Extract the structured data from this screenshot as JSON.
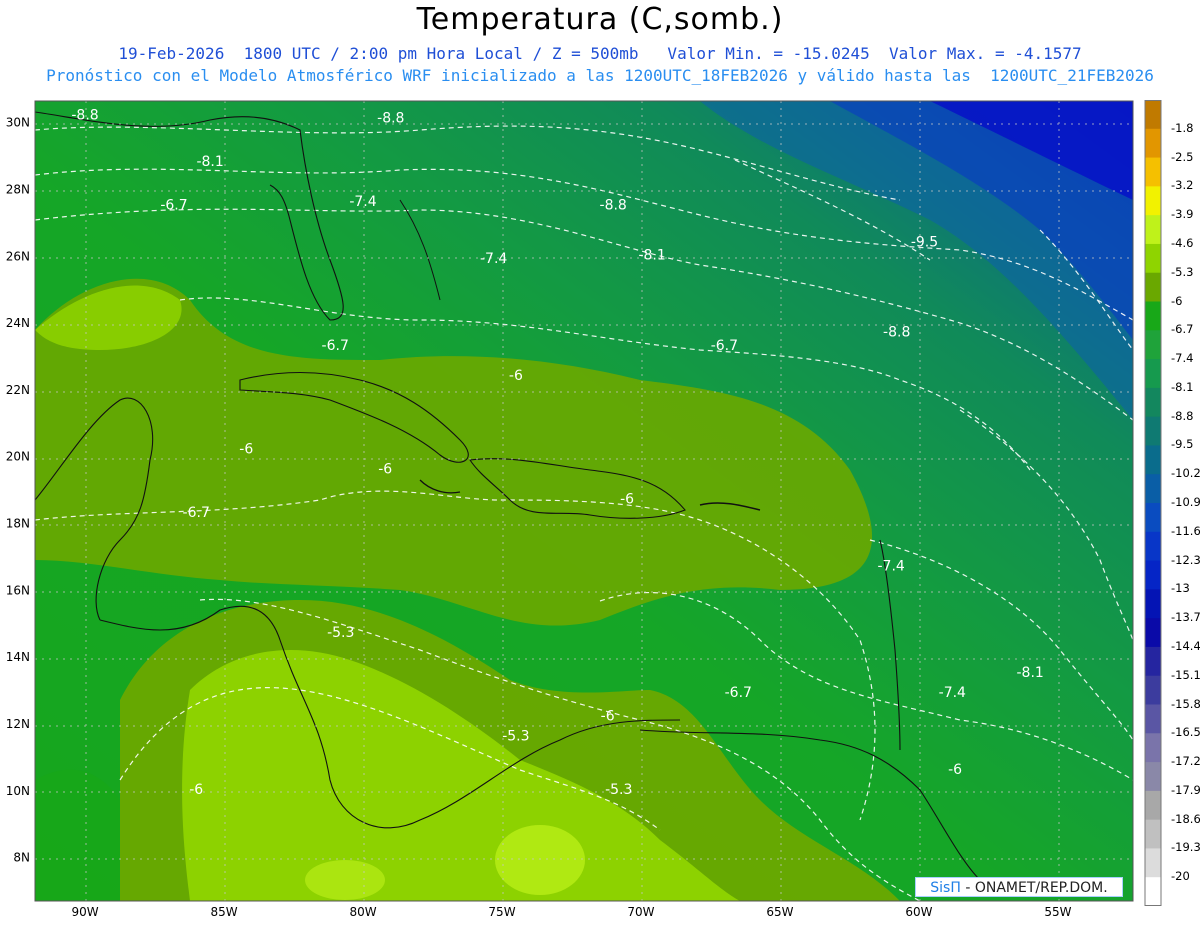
{
  "title": "Temperatura (C,somb.)",
  "subtitle_line1": "19-Feb-2026  1800 UTC / 2:00 pm Hora Local / Z = 500mb   Valor Min. = -15.0245  Valor Max. = -4.1577",
  "subtitle_line2": "Pronóstico con el Modelo Atmosférico WRF inicializado a las 1200UTC_18FEB2026 y válido hasta las  1200UTC_21FEB2026",
  "map": {
    "lon_labels": [
      "90W",
      "85W",
      "80W",
      "75W",
      "70W",
      "65W",
      "60W",
      "55W"
    ],
    "lat_labels": [
      "30N",
      "28N",
      "26N",
      "24N",
      "22N",
      "20N",
      "18N",
      "16N",
      "14N",
      "12N",
      "10N",
      "8N"
    ],
    "contour_labels": [
      {
        "text": "-8.8",
        "lon": -90.0,
        "lat": 30.1
      },
      {
        "text": "-8.8",
        "lon": -79.0,
        "lat": 30.0
      },
      {
        "text": "-8.1",
        "lon": -85.5,
        "lat": 28.7
      },
      {
        "text": "-6.7",
        "lon": -86.8,
        "lat": 27.4
      },
      {
        "text": "-7.4",
        "lon": -80.0,
        "lat": 27.5
      },
      {
        "text": "-8.8",
        "lon": -71.0,
        "lat": 27.4
      },
      {
        "text": "-7.4",
        "lon": -75.3,
        "lat": 25.8
      },
      {
        "text": "-8.1",
        "lon": -69.6,
        "lat": 25.9
      },
      {
        "text": "-9.5",
        "lon": -59.8,
        "lat": 26.3
      },
      {
        "text": "-8.8",
        "lon": -60.8,
        "lat": 23.6
      },
      {
        "text": "-6.7",
        "lon": -81.0,
        "lat": 23.2
      },
      {
        "text": "-6.7",
        "lon": -67.0,
        "lat": 23.2
      },
      {
        "text": "-6",
        "lon": -74.5,
        "lat": 22.3
      },
      {
        "text": "-6",
        "lon": -84.2,
        "lat": 20.1
      },
      {
        "text": "-6",
        "lon": -79.2,
        "lat": 19.5
      },
      {
        "text": "-6",
        "lon": -70.5,
        "lat": 18.6
      },
      {
        "text": "-6.7",
        "lon": -86.0,
        "lat": 18.2
      },
      {
        "text": "-7.4",
        "lon": -61.0,
        "lat": 16.6
      },
      {
        "text": "-5.3",
        "lon": -80.8,
        "lat": 14.6
      },
      {
        "text": "-8.1",
        "lon": -56.0,
        "lat": 13.4
      },
      {
        "text": "-6.7",
        "lon": -66.5,
        "lat": 12.8
      },
      {
        "text": "-7.4",
        "lon": -58.8,
        "lat": 12.8
      },
      {
        "text": "-6",
        "lon": -71.2,
        "lat": 12.1
      },
      {
        "text": "-5.3",
        "lon": -74.5,
        "lat": 11.5
      },
      {
        "text": "-6",
        "lon": -86.0,
        "lat": 9.9
      },
      {
        "text": "-5.3",
        "lon": -70.8,
        "lat": 9.9
      },
      {
        "text": "-6",
        "lon": -58.7,
        "lat": 10.5
      }
    ]
  },
  "colorbar": {
    "labels": [
      "-1.8",
      "-2.5",
      "-3.2",
      "-3.9",
      "-4.6",
      "-5.3",
      "-6",
      "-6.7",
      "-7.4",
      "-8.1",
      "-8.8",
      "-9.5",
      "-10.2",
      "-10.9",
      "-11.6",
      "-12.3",
      "-13",
      "-13.7",
      "-14.4",
      "-15.1",
      "-15.8",
      "-16.5",
      "-17.2",
      "-17.9",
      "-18.6",
      "-19.3",
      "-20"
    ],
    "colors": [
      "#c07a00",
      "#e29600",
      "#f5c000",
      "#f2f200",
      "#bff21a",
      "#8fd400",
      "#6aa800",
      "#18a818",
      "#1fa33a",
      "#169a4e",
      "#13875e",
      "#0f7a72",
      "#0a6c8c",
      "#0a5ea6",
      "#0a4cc0",
      "#0836c8",
      "#0525c6",
      "#0414b4",
      "#0a0aa8",
      "#2525a0",
      "#3c3c9e",
      "#5a56a4",
      "#7a74aa",
      "#8a88a8",
      "#a8a8a8",
      "#c0c0c0",
      "#dcdcdc",
      "#ffffff"
    ]
  },
  "credit": {
    "brand": "SisΠ",
    "text": " - ONAMET/REP.DOM."
  },
  "colors": {
    "ocean_green": "#18a818",
    "deep_blue": "#0a0ac8",
    "land_green": "#6aa800",
    "light_green": "#8fd400"
  }
}
